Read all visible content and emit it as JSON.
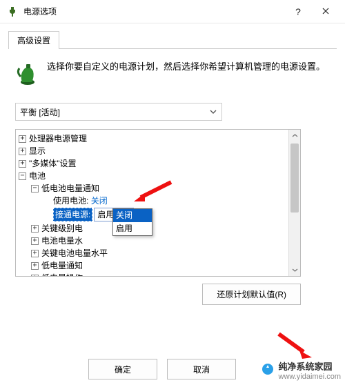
{
  "window": {
    "title": "电源选项",
    "help_icon": "help-icon",
    "close_icon": "close-icon"
  },
  "tab": {
    "label": "高级设置"
  },
  "intro": "选择你要自定义的电源计划，然后选择你希望计算机管理的电源设置。",
  "plan": {
    "selected": "平衡 [活动]"
  },
  "tree": {
    "n1": "处理器电源管理",
    "n2": "显示",
    "n3": "\"多媒体\"设置",
    "n4": "电池",
    "n4a": "低电池电量通知",
    "n4a1_label": "使用电池:",
    "n4a1_value": "关闭",
    "n4a2_label": "接通电源:",
    "n4a2_value": "启用",
    "n4b": "关键级别电",
    "n4c": "电池电量水",
    "n4d": "关键电池电量水平",
    "n4e": "低电量通知",
    "n4f": "低电量操作"
  },
  "dropdown": {
    "opt1": "关闭",
    "opt2": "启用"
  },
  "buttons": {
    "restore": "还原计划默认值(R)",
    "ok": "确定",
    "cancel": "取消"
  },
  "watermark": {
    "name": "纯净系统家园",
    "url": "www.yidaimei.com"
  }
}
